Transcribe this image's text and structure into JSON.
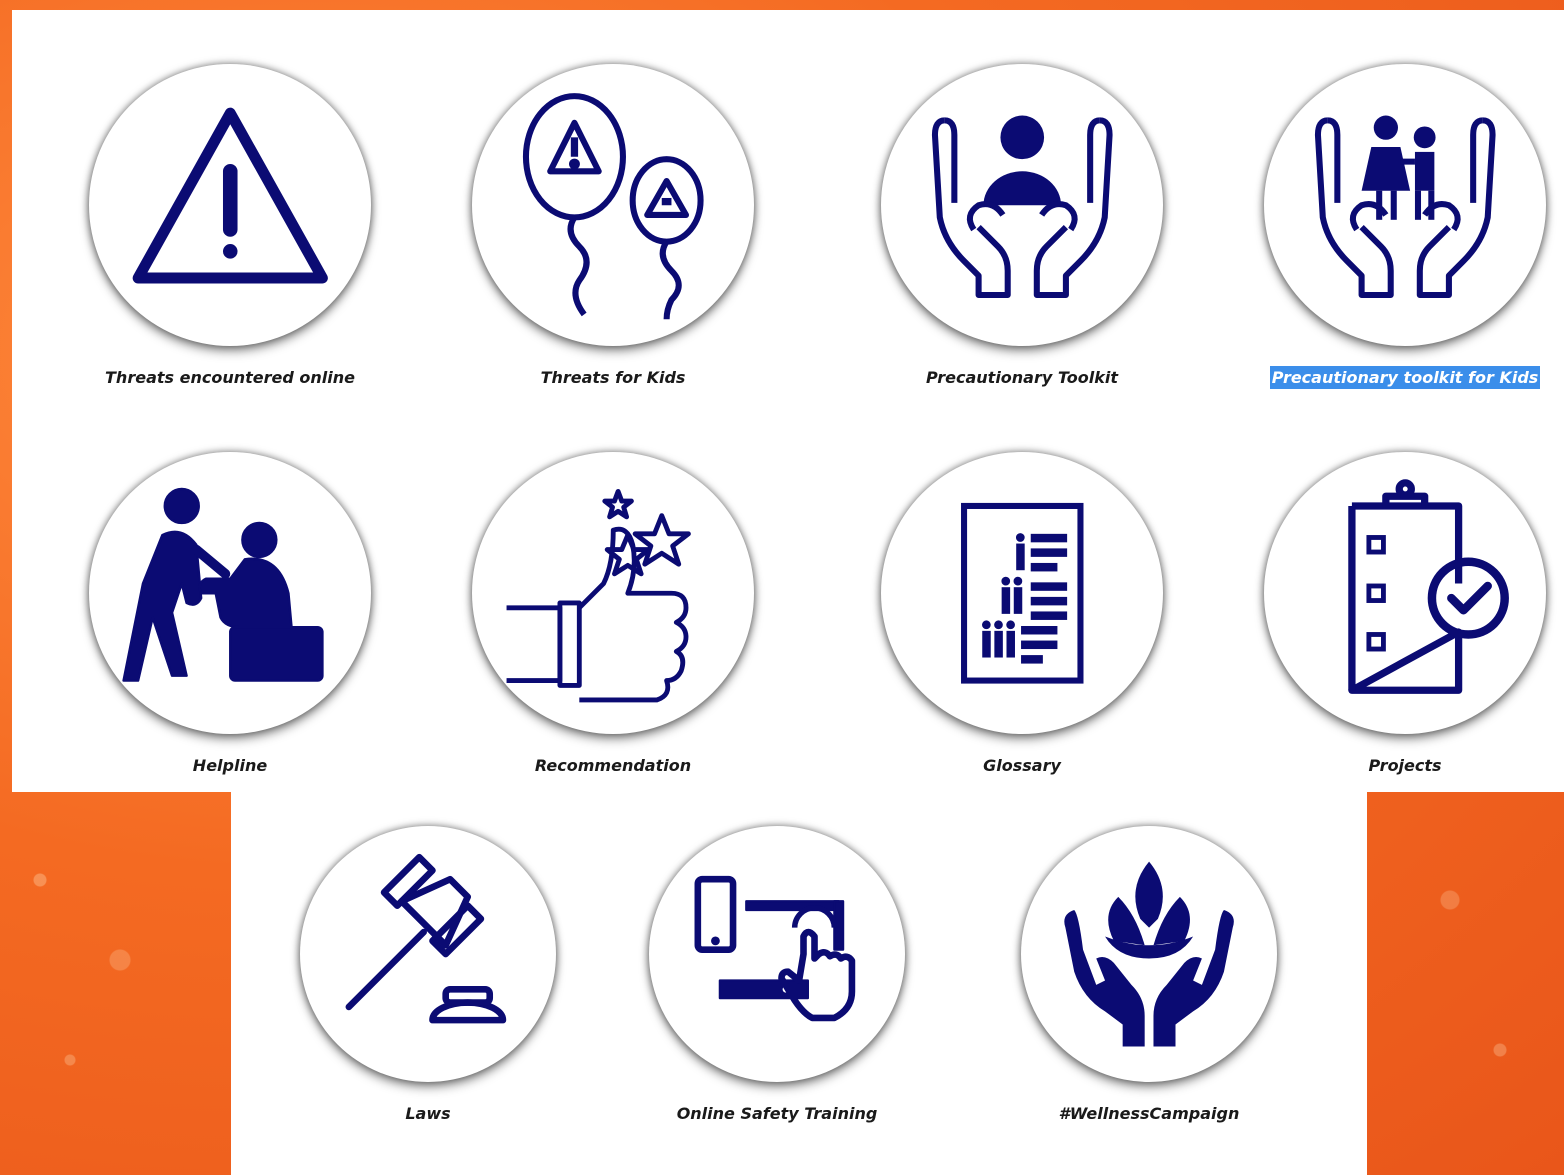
{
  "tiles": [
    {
      "id": "threats-online",
      "label": "Threats encountered online",
      "icon": "warning-triangle-icon"
    },
    {
      "id": "threats-kids",
      "label": "Threats for Kids",
      "icon": "warning-balloons-icon"
    },
    {
      "id": "toolkit",
      "label": "Precautionary Toolkit",
      "icon": "person-in-hands-icon"
    },
    {
      "id": "toolkit-kids",
      "label": "Precautionary toolkit for Kids",
      "icon": "children-in-hands-icon",
      "selected": true
    },
    {
      "id": "helpline",
      "label": "Helpline",
      "icon": "helping-person-icon"
    },
    {
      "id": "recommendation",
      "label": "Recommendation",
      "icon": "thumbs-up-stars-icon"
    },
    {
      "id": "glossary",
      "label": "Glossary",
      "icon": "glossary-list-icon"
    },
    {
      "id": "projects",
      "label": "Projects",
      "icon": "clipboard-check-icon"
    },
    {
      "id": "laws",
      "label": "Laws",
      "icon": "gavel-icon"
    },
    {
      "id": "training",
      "label": "Online Safety Training",
      "icon": "devices-touch-icon"
    },
    {
      "id": "wellness",
      "label": "#WellnessCampaign",
      "icon": "lotus-hands-icon"
    }
  ],
  "colors": {
    "icon": "#0b0b73",
    "background": "#f46a22",
    "selection": "#3b8eea"
  }
}
